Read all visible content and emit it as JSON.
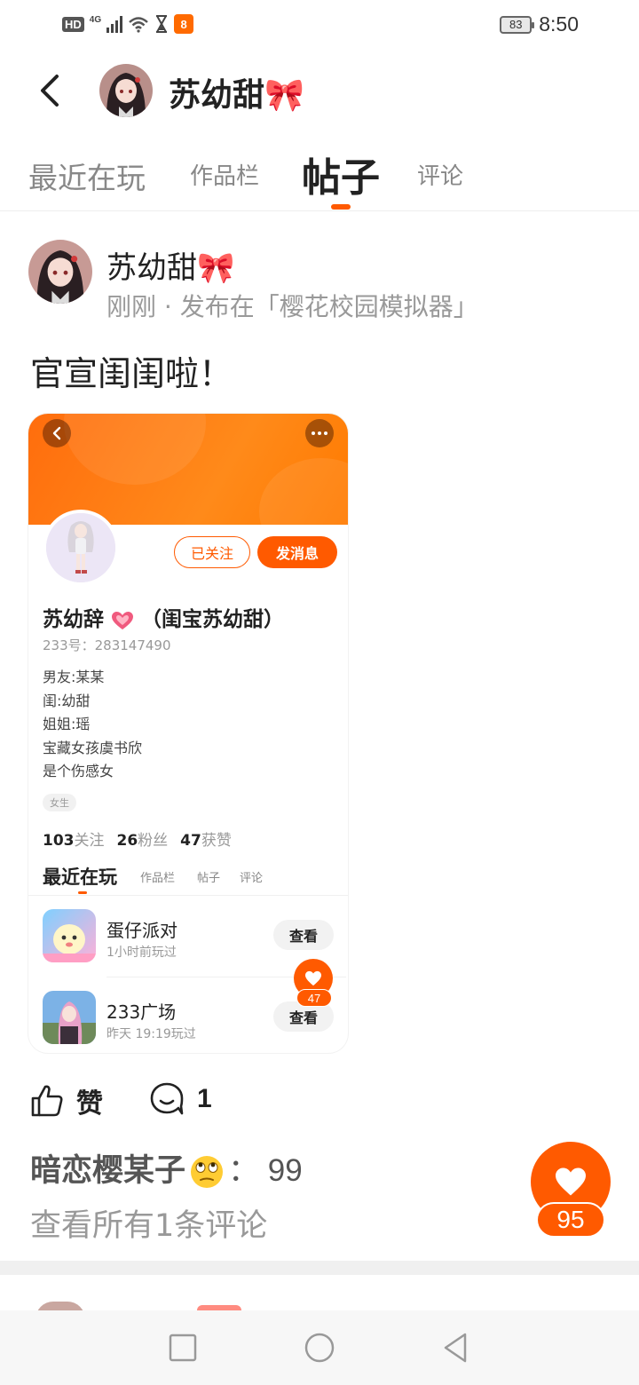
{
  "status_bar": {
    "hd": "HD",
    "network": "4G",
    "app_badge": "8",
    "battery": "83",
    "time": "8:50"
  },
  "header": {
    "name": "苏幼甜🎀"
  },
  "tabs": [
    {
      "label": "最近在玩"
    },
    {
      "label": "作品栏"
    },
    {
      "label": "帖子",
      "active": true
    },
    {
      "label": "评论"
    }
  ],
  "post": {
    "author_name": "苏幼甜🎀",
    "meta": "刚刚 · 发布在「樱花校园模拟器」",
    "text": "官宣闺闺啦！"
  },
  "embedded_profile": {
    "followed_label": "已关注",
    "message_label": "发消息",
    "name_prefix": "苏幼辞",
    "name_suffix": "（闺宝苏幼甜）",
    "id_line": "233号：283147490",
    "bio": [
      "男友:某某",
      "闺:幼甜",
      "姐姐:瑶",
      "宝藏女孩虞书欣",
      "是个伤感女"
    ],
    "tag": "女生",
    "stats": {
      "following_count": "103",
      "following_label": "关注",
      "fans_count": "26",
      "fans_label": "粉丝",
      "likes_count": "47",
      "likes_label": "获赞"
    },
    "tabs": [
      "最近在玩",
      "作品栏",
      "帖子",
      "评论"
    ],
    "games": [
      {
        "name": "蛋仔派对",
        "time": "1小时前玩过",
        "button": "查看"
      },
      {
        "name": "233广场",
        "time": "昨天 19:19玩过",
        "button": "查看"
      }
    ],
    "like_count": "47"
  },
  "actions": {
    "like_label": "赞",
    "comment_count": "1"
  },
  "comment": {
    "user": "暗恋樱某子",
    "text": "： 99"
  },
  "view_all": "查看所有1条评论",
  "float_like_count": "95",
  "colors": {
    "accent": "#ff5a00"
  }
}
